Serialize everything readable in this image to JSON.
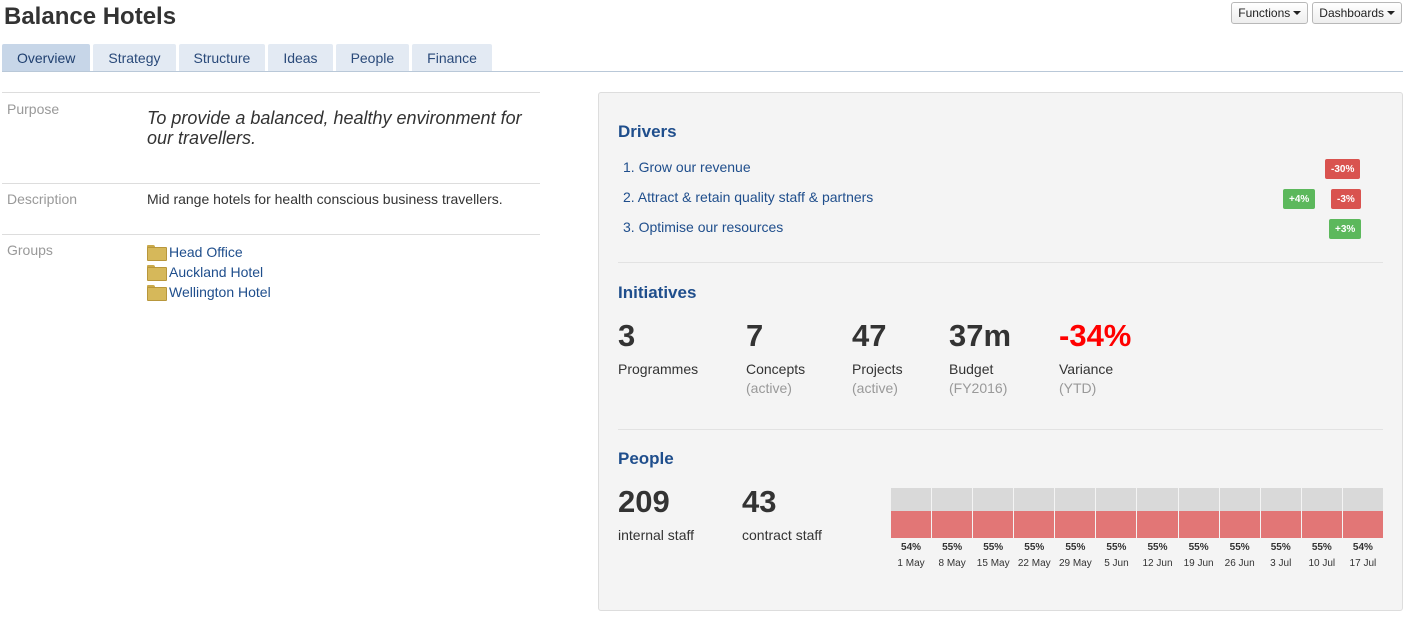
{
  "page": {
    "title": "Balance Hotels"
  },
  "top_buttons": {
    "functions": "Functions",
    "dashboards": "Dashboards"
  },
  "tabs": [
    "Overview",
    "Strategy",
    "Structure",
    "Ideas",
    "People",
    "Finance"
  ],
  "details": {
    "purpose_label": "Purpose",
    "purpose_value": "To provide a balanced, healthy environment for our travellers.",
    "description_label": "Description",
    "description_value": "Mid range hotels for health conscious business travellers.",
    "groups_label": "Groups",
    "groups": [
      "Head Office",
      "Auckland Hotel",
      "Wellington Hotel"
    ]
  },
  "drivers": {
    "title": "Drivers",
    "items": [
      {
        "label": "1. Grow our revenue",
        "badges": [
          {
            "text": "-30%",
            "color": "#d9534f"
          }
        ]
      },
      {
        "label": "2. Attract & retain quality staff & partners",
        "badges": [
          {
            "text": "+4%",
            "color": "#5cb85c"
          },
          {
            "text": "-3%",
            "color": "#d9534f"
          }
        ]
      },
      {
        "label": "3. Optimise our resources",
        "badges": [
          {
            "text": "+3%",
            "color": "#5cb85c"
          }
        ]
      }
    ]
  },
  "initiatives": {
    "title": "Initiatives",
    "stats": [
      {
        "value": "3",
        "label": "Programmes",
        "sub": ""
      },
      {
        "value": "7",
        "label": "Concepts",
        "sub": "(active)"
      },
      {
        "value": "47",
        "label": "Projects",
        "sub": "(active)"
      },
      {
        "value": "37m",
        "label": "Budget",
        "sub": "(FY2016)"
      },
      {
        "value": "-34%",
        "label": "Variance",
        "sub": "(YTD)",
        "color": "#ff0000"
      }
    ]
  },
  "people": {
    "title": "People",
    "internal_value": "209",
    "internal_label": "internal staff",
    "contract_value": "43",
    "contract_label": "contract staff",
    "utilisation": [
      {
        "date": "1 May",
        "percent": 54
      },
      {
        "date": "8 May",
        "percent": 55
      },
      {
        "date": "15 May",
        "percent": 55
      },
      {
        "date": "22 May",
        "percent": 55
      },
      {
        "date": "29 May",
        "percent": 55
      },
      {
        "date": "5 Jun",
        "percent": 55
      },
      {
        "date": "12 Jun",
        "percent": 55
      },
      {
        "date": "19 Jun",
        "percent": 55
      },
      {
        "date": "26 Jun",
        "percent": 55
      },
      {
        "date": "3 Jul",
        "percent": 55
      },
      {
        "date": "10 Jul",
        "percent": 55
      },
      {
        "date": "17 Jul",
        "percent": 54
      }
    ],
    "fill_color": "#e27676",
    "empty_color": "#d9d9d9"
  }
}
